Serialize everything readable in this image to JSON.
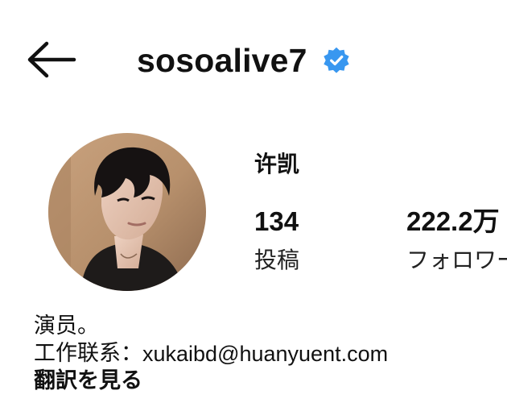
{
  "header": {
    "back_icon": "arrow-left-icon",
    "username": "sosoalive7",
    "verified_icon": "verified-badge-icon",
    "verified_color": "#3897f0"
  },
  "profile": {
    "avatar_icon": "profile-photo",
    "display_name": "许凯",
    "stats": {
      "posts": {
        "value": "134",
        "label": "投稿"
      },
      "followers": {
        "value": "222.2万",
        "label": "フォロワー"
      }
    }
  },
  "bio": {
    "line1": "演员。",
    "contact_label": "工作联系：",
    "contact_email": "xukaibd@huanyuent.com",
    "translate_label": "翻訳を見る"
  }
}
